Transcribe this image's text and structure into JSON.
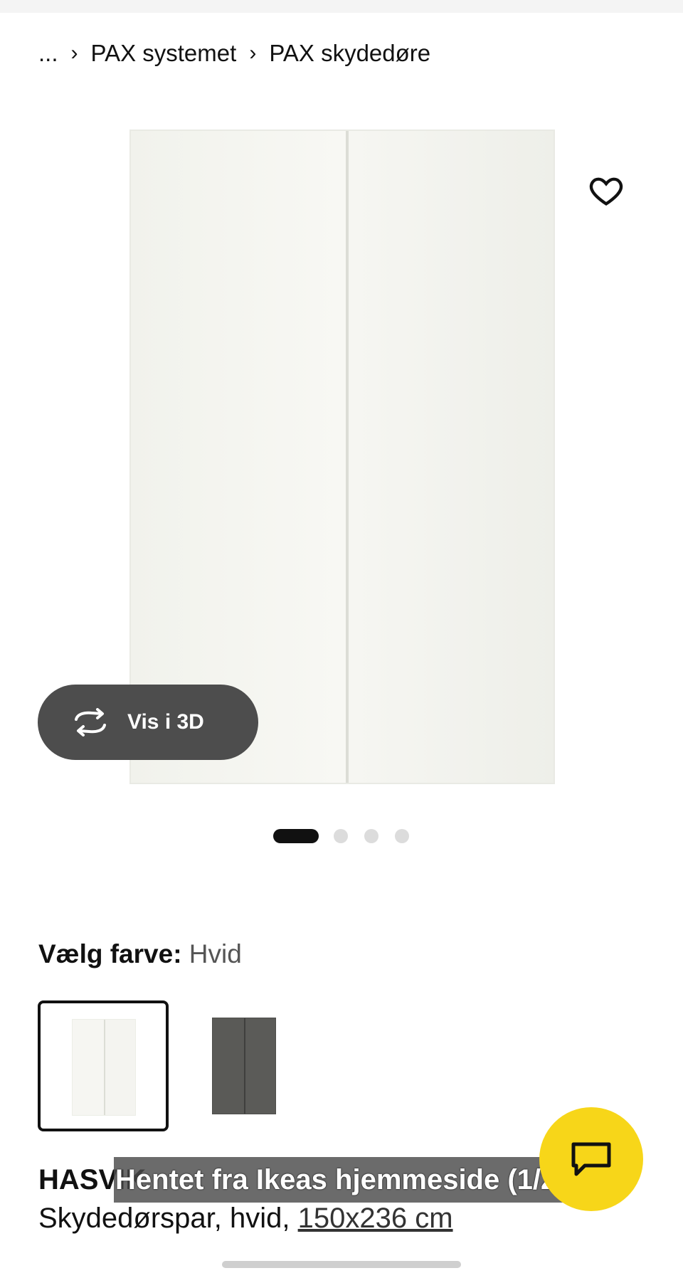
{
  "breadcrumb": {
    "ellipsis": "...",
    "items": [
      "PAX systemet",
      "PAX skydedøre"
    ]
  },
  "gallery": {
    "view_3d_label": "Vis i 3D",
    "image_count": 4,
    "active_index": 0
  },
  "color": {
    "title": "Vælg farve:",
    "value": "Hvid",
    "options": [
      {
        "name": "Hvid",
        "selected": true,
        "hex": "#f7f7f3"
      },
      {
        "name": "Grå",
        "selected": false,
        "hex": "#5a5a57"
      }
    ]
  },
  "product": {
    "name": "HASVIK",
    "description": "Skydedørspar, hvid, ",
    "size_link": "150x236 cm"
  },
  "caption": "Hentet fra Ikeas hjemmeside (1/2)",
  "colors": {
    "chat": "#f7d619",
    "overlay": "#4d4d4d"
  }
}
